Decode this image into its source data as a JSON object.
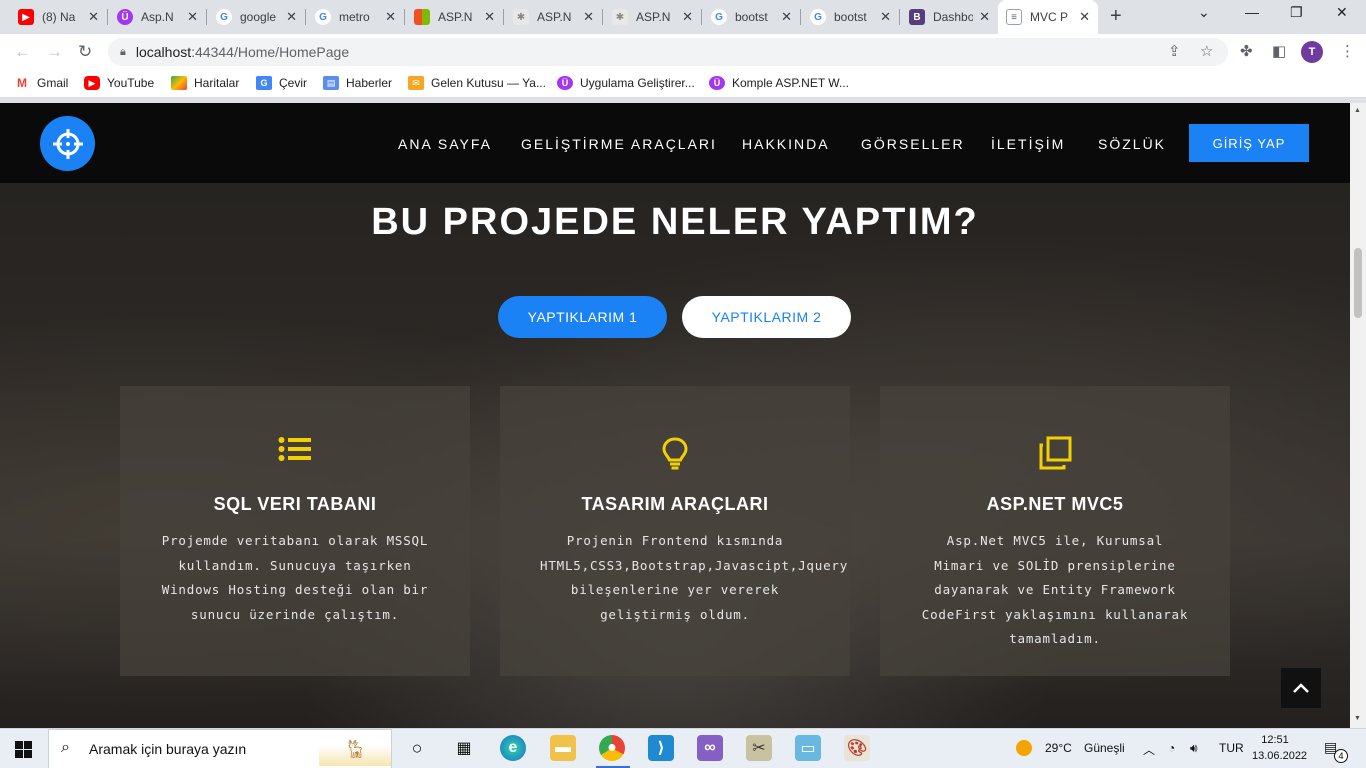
{
  "browser": {
    "tabs": [
      {
        "title": "(8) Na",
        "fav": "youtube-icon"
      },
      {
        "title": "Asp.N",
        "fav": "udemy-icon"
      },
      {
        "title": "google",
        "fav": "google-icon"
      },
      {
        "title": "metro",
        "fav": "google-icon"
      },
      {
        "title": "ASP.N",
        "fav": "microsoft-icon"
      },
      {
        "title": "ASP.N",
        "fav": "aspnet-icon"
      },
      {
        "title": "ASP.N",
        "fav": "aspnet-icon"
      },
      {
        "title": "bootst",
        "fav": "google-icon"
      },
      {
        "title": "bootst",
        "fav": "google-icon"
      },
      {
        "title": "Dashbo",
        "fav": "bootstrap-icon"
      },
      {
        "title": "MVC P",
        "fav": "page-icon"
      }
    ],
    "url_host": "localhost",
    "url_port_path": ":44344/Home/HomePage",
    "profile_initial": "T",
    "bookmarks": [
      {
        "label": "Gmail",
        "icon": "gmail-icon"
      },
      {
        "label": "YouTube",
        "icon": "youtube-icon"
      },
      {
        "label": "Haritalar",
        "icon": "maps-icon"
      },
      {
        "label": "Çevir",
        "icon": "translate-icon"
      },
      {
        "label": "Haberler",
        "icon": "news-icon"
      },
      {
        "label": "Gelen Kutusu — Ya...",
        "icon": "mail-icon"
      },
      {
        "label": "Uygulama Geliştirer...",
        "icon": "udemy-icon"
      },
      {
        "label": "Komple ASP.NET W...",
        "icon": "udemy-icon"
      }
    ]
  },
  "site": {
    "nav": [
      "ANA SAYFA",
      "GELİŞTİRME ARAÇLARI",
      "HAKKINDA",
      "GÖRSELLER",
      "İLETİŞİM",
      "SÖZLÜK"
    ],
    "login": "GİRİŞ YAP",
    "section_title": "BU PROJEDE NELER YAPTIM?",
    "tab_one": "YAPTIKLARIM 1",
    "tab_two": "YAPTIKLARIM 2",
    "accent_color": "#1a82f5",
    "icon_color": "#f5d000",
    "cards": [
      {
        "icon": "list-icon",
        "title": "SQL VERI TABANI",
        "text": "Projemde veritabanı olarak MSSQL kullandım. Sunucuya taşırken Windows Hosting desteği olan bir sunucu üzerinde çalıştım."
      },
      {
        "icon": "lightbulb-icon",
        "title": "TASARIM ARAÇLARI",
        "text": "Projenin Frontend kısmında HTML5,CSS3,Bootstrap,Javascipt,Jquery bileşenlerine yer vererek geliştirmiş oldum."
      },
      {
        "icon": "copy-icon",
        "title": "ASP.NET MVC5",
        "text": "Asp.Net MVC5 ile, Kurumsal Mimari ve SOLİD prensiplerine dayanarak ve Entity Framework CodeFirst yaklaşımını kullanarak tamamladım."
      }
    ]
  },
  "taskbar": {
    "search_placeholder": "Aramak için buraya yazın",
    "temperature": "29°C",
    "weather": "Güneşli",
    "language": "TUR",
    "time": "12:51",
    "date": "13.06.2022",
    "notifications": "4"
  }
}
